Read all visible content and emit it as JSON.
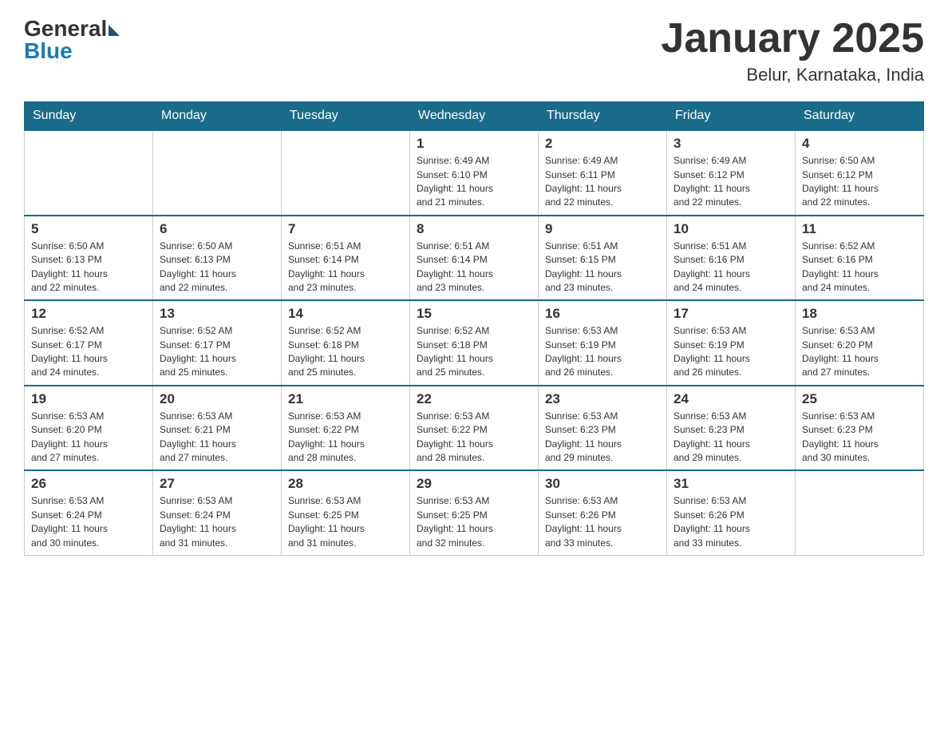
{
  "header": {
    "logo_general": "General",
    "logo_blue": "Blue",
    "month": "January 2025",
    "location": "Belur, Karnataka, India"
  },
  "days_of_week": [
    "Sunday",
    "Monday",
    "Tuesday",
    "Wednesday",
    "Thursday",
    "Friday",
    "Saturday"
  ],
  "weeks": [
    [
      {
        "day": "",
        "info": ""
      },
      {
        "day": "",
        "info": ""
      },
      {
        "day": "",
        "info": ""
      },
      {
        "day": "1",
        "info": "Sunrise: 6:49 AM\nSunset: 6:10 PM\nDaylight: 11 hours\nand 21 minutes."
      },
      {
        "day": "2",
        "info": "Sunrise: 6:49 AM\nSunset: 6:11 PM\nDaylight: 11 hours\nand 22 minutes."
      },
      {
        "day": "3",
        "info": "Sunrise: 6:49 AM\nSunset: 6:12 PM\nDaylight: 11 hours\nand 22 minutes."
      },
      {
        "day": "4",
        "info": "Sunrise: 6:50 AM\nSunset: 6:12 PM\nDaylight: 11 hours\nand 22 minutes."
      }
    ],
    [
      {
        "day": "5",
        "info": "Sunrise: 6:50 AM\nSunset: 6:13 PM\nDaylight: 11 hours\nand 22 minutes."
      },
      {
        "day": "6",
        "info": "Sunrise: 6:50 AM\nSunset: 6:13 PM\nDaylight: 11 hours\nand 22 minutes."
      },
      {
        "day": "7",
        "info": "Sunrise: 6:51 AM\nSunset: 6:14 PM\nDaylight: 11 hours\nand 23 minutes."
      },
      {
        "day": "8",
        "info": "Sunrise: 6:51 AM\nSunset: 6:14 PM\nDaylight: 11 hours\nand 23 minutes."
      },
      {
        "day": "9",
        "info": "Sunrise: 6:51 AM\nSunset: 6:15 PM\nDaylight: 11 hours\nand 23 minutes."
      },
      {
        "day": "10",
        "info": "Sunrise: 6:51 AM\nSunset: 6:16 PM\nDaylight: 11 hours\nand 24 minutes."
      },
      {
        "day": "11",
        "info": "Sunrise: 6:52 AM\nSunset: 6:16 PM\nDaylight: 11 hours\nand 24 minutes."
      }
    ],
    [
      {
        "day": "12",
        "info": "Sunrise: 6:52 AM\nSunset: 6:17 PM\nDaylight: 11 hours\nand 24 minutes."
      },
      {
        "day": "13",
        "info": "Sunrise: 6:52 AM\nSunset: 6:17 PM\nDaylight: 11 hours\nand 25 minutes."
      },
      {
        "day": "14",
        "info": "Sunrise: 6:52 AM\nSunset: 6:18 PM\nDaylight: 11 hours\nand 25 minutes."
      },
      {
        "day": "15",
        "info": "Sunrise: 6:52 AM\nSunset: 6:18 PM\nDaylight: 11 hours\nand 25 minutes."
      },
      {
        "day": "16",
        "info": "Sunrise: 6:53 AM\nSunset: 6:19 PM\nDaylight: 11 hours\nand 26 minutes."
      },
      {
        "day": "17",
        "info": "Sunrise: 6:53 AM\nSunset: 6:19 PM\nDaylight: 11 hours\nand 26 minutes."
      },
      {
        "day": "18",
        "info": "Sunrise: 6:53 AM\nSunset: 6:20 PM\nDaylight: 11 hours\nand 27 minutes."
      }
    ],
    [
      {
        "day": "19",
        "info": "Sunrise: 6:53 AM\nSunset: 6:20 PM\nDaylight: 11 hours\nand 27 minutes."
      },
      {
        "day": "20",
        "info": "Sunrise: 6:53 AM\nSunset: 6:21 PM\nDaylight: 11 hours\nand 27 minutes."
      },
      {
        "day": "21",
        "info": "Sunrise: 6:53 AM\nSunset: 6:22 PM\nDaylight: 11 hours\nand 28 minutes."
      },
      {
        "day": "22",
        "info": "Sunrise: 6:53 AM\nSunset: 6:22 PM\nDaylight: 11 hours\nand 28 minutes."
      },
      {
        "day": "23",
        "info": "Sunrise: 6:53 AM\nSunset: 6:23 PM\nDaylight: 11 hours\nand 29 minutes."
      },
      {
        "day": "24",
        "info": "Sunrise: 6:53 AM\nSunset: 6:23 PM\nDaylight: 11 hours\nand 29 minutes."
      },
      {
        "day": "25",
        "info": "Sunrise: 6:53 AM\nSunset: 6:23 PM\nDaylight: 11 hours\nand 30 minutes."
      }
    ],
    [
      {
        "day": "26",
        "info": "Sunrise: 6:53 AM\nSunset: 6:24 PM\nDaylight: 11 hours\nand 30 minutes."
      },
      {
        "day": "27",
        "info": "Sunrise: 6:53 AM\nSunset: 6:24 PM\nDaylight: 11 hours\nand 31 minutes."
      },
      {
        "day": "28",
        "info": "Sunrise: 6:53 AM\nSunset: 6:25 PM\nDaylight: 11 hours\nand 31 minutes."
      },
      {
        "day": "29",
        "info": "Sunrise: 6:53 AM\nSunset: 6:25 PM\nDaylight: 11 hours\nand 32 minutes."
      },
      {
        "day": "30",
        "info": "Sunrise: 6:53 AM\nSunset: 6:26 PM\nDaylight: 11 hours\nand 33 minutes."
      },
      {
        "day": "31",
        "info": "Sunrise: 6:53 AM\nSunset: 6:26 PM\nDaylight: 11 hours\nand 33 minutes."
      },
      {
        "day": "",
        "info": ""
      }
    ]
  ]
}
